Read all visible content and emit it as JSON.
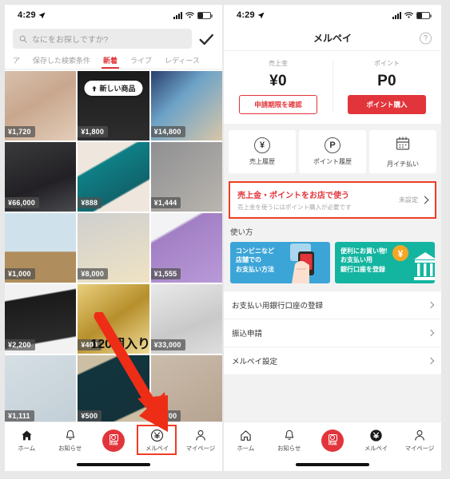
{
  "left_phone": {
    "status": {
      "time": "4:29",
      "location_icon": "location-arrow-icon"
    },
    "search": {
      "placeholder": "なにをお探しですか?",
      "icon": "search-icon",
      "confirm_icon": "checkmark-icon"
    },
    "tabs": [
      {
        "label": "ア",
        "active": false
      },
      {
        "label": "保存した検索条件",
        "active": false
      },
      {
        "label": "新着",
        "active": true
      },
      {
        "label": "ライブ",
        "active": false
      },
      {
        "label": "レディース",
        "active": false
      }
    ],
    "products": [
      {
        "price": "¥1,720",
        "badge": "",
        "overlay": ""
      },
      {
        "price": "¥1,800",
        "badge": "新しい商品",
        "overlay": ""
      },
      {
        "price": "¥14,800",
        "badge": "",
        "overlay": ""
      },
      {
        "price": "¥66,000",
        "badge": "",
        "overlay": ""
      },
      {
        "price": "¥888",
        "badge": "",
        "overlay": ""
      },
      {
        "price": "¥1,444",
        "badge": "",
        "overlay": ""
      },
      {
        "price": "¥1,000",
        "badge": "",
        "overlay": ""
      },
      {
        "price": "¥8,000",
        "badge": "",
        "overlay": ""
      },
      {
        "price": "¥1,555",
        "badge": "",
        "overlay": ""
      },
      {
        "price": "¥2,200",
        "badge": "",
        "overlay": ""
      },
      {
        "price": "¥400",
        "badge": "",
        "overlay": "120個入り"
      },
      {
        "price": "¥33,000",
        "badge": "",
        "overlay": ""
      },
      {
        "price": "¥1,111",
        "badge": "",
        "overlay": ""
      },
      {
        "price": "¥500",
        "badge": "",
        "overlay": ""
      },
      {
        "price": "¥3,700",
        "badge": "",
        "overlay": ""
      }
    ],
    "nav": [
      {
        "label": "ホーム",
        "icon": "home-icon",
        "active": true,
        "highlighted": false
      },
      {
        "label": "お知らせ",
        "icon": "bell-icon",
        "active": false,
        "highlighted": false
      },
      {
        "label": "出品",
        "icon": "camera-icon",
        "active": false,
        "highlighted": false
      },
      {
        "label": "メルペイ",
        "icon": "yen-circle-icon",
        "active": false,
        "highlighted": true
      },
      {
        "label": "マイページ",
        "icon": "person-icon",
        "active": false,
        "highlighted": false
      }
    ]
  },
  "right_phone": {
    "status": {
      "time": "4:29",
      "location_icon": "location-arrow-icon"
    },
    "header": {
      "title": "メルペイ",
      "help_icon": "question-mark-icon",
      "help_label": "?"
    },
    "balance": [
      {
        "label": "売上金",
        "value": "¥0",
        "button": "申請期限を確認",
        "button_style": "outline"
      },
      {
        "label": "ポイント",
        "value": "P0",
        "button": "ポイント購入",
        "button_style": "filled"
      }
    ],
    "tiles": [
      {
        "label": "売上履歴",
        "icon": "yen-circle-icon",
        "glyph": "¥"
      },
      {
        "label": "ポイント履歴",
        "icon": "point-circle-icon",
        "glyph": "P"
      },
      {
        "label": "月イチ払い",
        "icon": "calendar-icon",
        "glyph": ""
      }
    ],
    "use_in_store": {
      "title": "売上金・ポイントをお店で使う",
      "subtitle": "売上金を使うにはポイント購入が必要です",
      "state": "未設定",
      "chevron_icon": "chevron-right-icon"
    },
    "howto": {
      "title": "使い方",
      "banners": [
        {
          "lines": [
            "コンビニなど",
            "店舗での",
            "お支払い方法"
          ],
          "color": "#3ca5d8",
          "art": "hand-phone-illustration"
        },
        {
          "lines": [
            "便利にお買い物!",
            "お支払い用",
            "銀行口座を登録"
          ],
          "color": "#14b5a0",
          "art": "bank-coin-illustration"
        }
      ]
    },
    "list_rows": [
      {
        "label": "お支払い用銀行口座の登録",
        "chevron_icon": "chevron-right-icon"
      },
      {
        "label": "振込申請",
        "chevron_icon": "chevron-right-icon"
      },
      {
        "label": "メルペイ設定",
        "chevron_icon": "chevron-right-icon"
      }
    ],
    "nav": [
      {
        "label": "ホーム",
        "icon": "home-icon",
        "active": false,
        "highlighted": false
      },
      {
        "label": "お知らせ",
        "icon": "bell-icon",
        "active": false,
        "highlighted": false
      },
      {
        "label": "出品",
        "icon": "camera-icon",
        "active": false,
        "highlighted": false
      },
      {
        "label": "メルペイ",
        "icon": "yen-circle-icon",
        "active": true,
        "highlighted": false
      },
      {
        "label": "マイページ",
        "icon": "person-icon",
        "active": false,
        "highlighted": false
      }
    ]
  },
  "annotation": {
    "arrow_icon": "red-arrow-down-right",
    "color": "#ee2d17"
  },
  "colors": {
    "accent_red": "#e2353b",
    "highlight_red": "#ef3d23",
    "banner_blue": "#3ca5d8",
    "banner_teal": "#14b5a0",
    "page_bg": "#f2f2f2"
  }
}
